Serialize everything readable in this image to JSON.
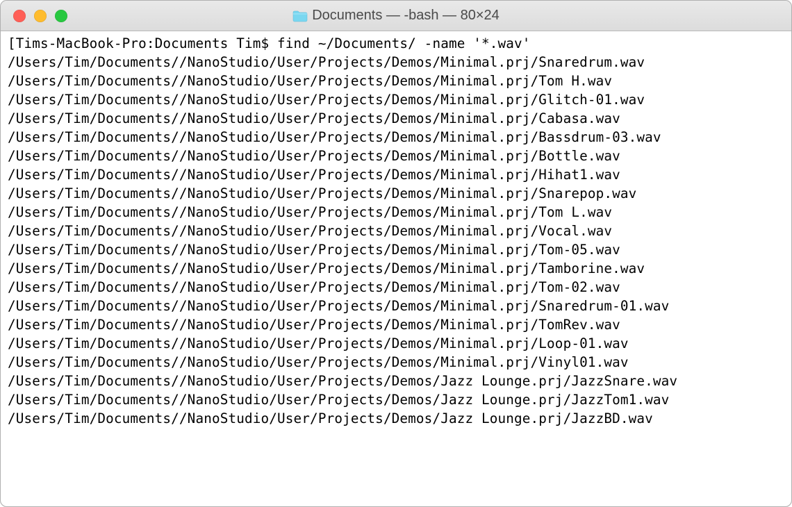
{
  "window": {
    "title": "Documents — -bash — 80×24"
  },
  "terminal": {
    "prompt_open": "[",
    "prompt": "Tims-MacBook-Pro:Documents Tim$ ",
    "command": "find ~/Documents/ -name '*.wav'",
    "output": [
      "/Users/Tim/Documents//NanoStudio/User/Projects/Demos/Minimal.prj/Snaredrum.wav",
      "/Users/Tim/Documents//NanoStudio/User/Projects/Demos/Minimal.prj/Tom H.wav",
      "/Users/Tim/Documents//NanoStudio/User/Projects/Demos/Minimal.prj/Glitch-01.wav",
      "/Users/Tim/Documents//NanoStudio/User/Projects/Demos/Minimal.prj/Cabasa.wav",
      "/Users/Tim/Documents//NanoStudio/User/Projects/Demos/Minimal.prj/Bassdrum-03.wav",
      "/Users/Tim/Documents//NanoStudio/User/Projects/Demos/Minimal.prj/Bottle.wav",
      "/Users/Tim/Documents//NanoStudio/User/Projects/Demos/Minimal.prj/Hihat1.wav",
      "/Users/Tim/Documents//NanoStudio/User/Projects/Demos/Minimal.prj/Snarepop.wav",
      "/Users/Tim/Documents//NanoStudio/User/Projects/Demos/Minimal.prj/Tom L.wav",
      "/Users/Tim/Documents//NanoStudio/User/Projects/Demos/Minimal.prj/Vocal.wav",
      "/Users/Tim/Documents//NanoStudio/User/Projects/Demos/Minimal.prj/Tom-05.wav",
      "/Users/Tim/Documents//NanoStudio/User/Projects/Demos/Minimal.prj/Tamborine.wav",
      "/Users/Tim/Documents//NanoStudio/User/Projects/Demos/Minimal.prj/Tom-02.wav",
      "/Users/Tim/Documents//NanoStudio/User/Projects/Demos/Minimal.prj/Snaredrum-01.wav",
      "/Users/Tim/Documents//NanoStudio/User/Projects/Demos/Minimal.prj/TomRev.wav",
      "/Users/Tim/Documents//NanoStudio/User/Projects/Demos/Minimal.prj/Loop-01.wav",
      "/Users/Tim/Documents//NanoStudio/User/Projects/Demos/Minimal.prj/Vinyl01.wav",
      "/Users/Tim/Documents//NanoStudio/User/Projects/Demos/Jazz Lounge.prj/JazzSnare.wav",
      "/Users/Tim/Documents//NanoStudio/User/Projects/Demos/Jazz Lounge.prj/JazzTom1.wav",
      "/Users/Tim/Documents//NanoStudio/User/Projects/Demos/Jazz Lounge.prj/JazzBD.wav"
    ]
  }
}
